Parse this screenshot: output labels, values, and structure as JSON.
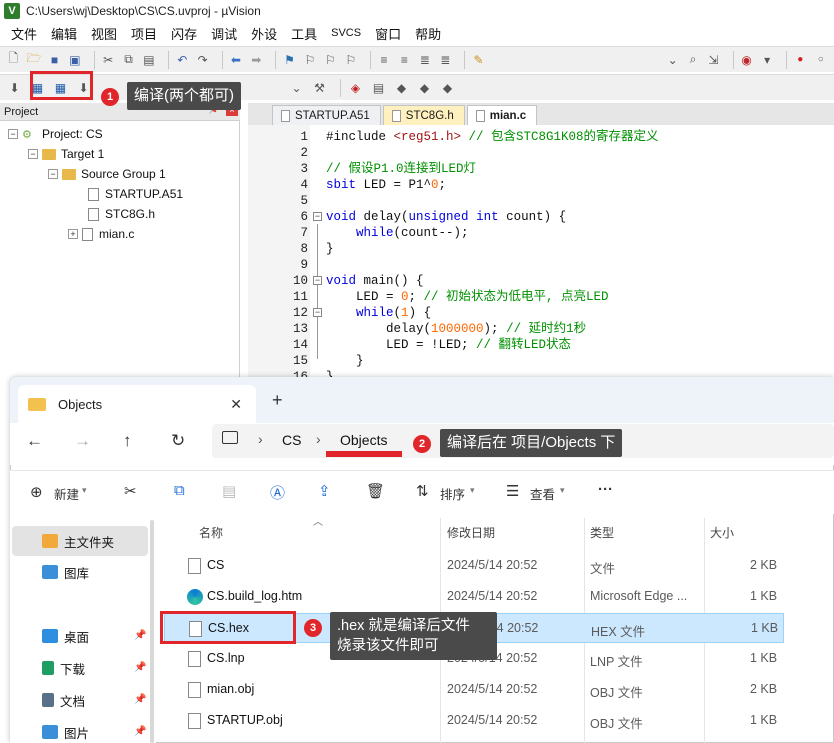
{
  "window": {
    "title": "C:\\Users\\wj\\Desktop\\CS\\CS.uvproj - µVision"
  },
  "menu": [
    "文件",
    "编辑",
    "视图",
    "项目",
    "闪存",
    "调试",
    "外设",
    "工具",
    "SVCS",
    "窗口",
    "帮助"
  ],
  "project": {
    "header": "Project",
    "tree": {
      "root": "Project: CS",
      "target": "Target 1",
      "group": "Source Group 1",
      "files": [
        "STARTUP.A51",
        "STC8G.h",
        "mian.c"
      ]
    }
  },
  "editor": {
    "tabs": [
      "STARTUP.A51",
      "STC8G.h",
      "mian.c"
    ],
    "active_tab": "mian.c",
    "line_numbers": [
      "1",
      "2",
      "3",
      "4",
      "5",
      "6",
      "7",
      "8",
      "9",
      "10",
      "11",
      "12",
      "13",
      "14",
      "15",
      "16"
    ],
    "lines": [
      "#include <reg51.h> // 包含STC8G1K08的寄存器定义",
      "",
      "// 假设P1.0连接到LED灯",
      "sbit LED = P1^0;",
      "",
      "void delay(unsigned int count) {",
      "    while(count--);",
      "}",
      "",
      "void main() {",
      "    LED = 0; // 初始状态为低电平, 点亮LED",
      "    while(1) {",
      "        delay(1000000); // 延时约1秒",
      "        LED = !LED; // 翻转LED状态",
      "    }",
      "}"
    ]
  },
  "annotations": {
    "one": {
      "num": "1",
      "text": "编译(两个都可)"
    },
    "two": {
      "num": "2",
      "text": "编译后在 项目/Objects 下"
    },
    "three": {
      "num": "3",
      "text_line1": ".hex 就是编译后文件",
      "text_line2": "烧录该文件即可"
    }
  },
  "explorer": {
    "tab_title": "Objects",
    "breadcrumb": [
      "CS",
      "Objects"
    ],
    "commands": {
      "new": "新建",
      "sort": "排序",
      "view": "查看",
      "more": "···"
    },
    "nav": [
      {
        "label": "主文件夹",
        "icon": "home-icon"
      },
      {
        "label": "图库",
        "icon": "gallery-icon"
      },
      {
        "label": "桌面",
        "icon": "desktop-icon"
      },
      {
        "label": "下载",
        "icon": "download-icon"
      },
      {
        "label": "文档",
        "icon": "document-icon"
      },
      {
        "label": "图片",
        "icon": "picture-icon"
      }
    ],
    "columns": [
      "名称",
      "修改日期",
      "类型",
      "大小"
    ],
    "files": [
      {
        "name": "CS",
        "date": "2024/5/14 20:52",
        "type": "文件",
        "size": "2 KB"
      },
      {
        "name": "CS.build_log.htm",
        "date": "2024/5/14 20:52",
        "type": "Microsoft Edge ...",
        "size": "1 KB"
      },
      {
        "name": "CS.hex",
        "date": "2024/5/14 20:52",
        "type": "HEX 文件",
        "size": "1 KB"
      },
      {
        "name": "CS.lnp",
        "date": "2024/5/14 20:52",
        "type": "LNP 文件",
        "size": "1 KB"
      },
      {
        "name": "mian.obj",
        "date": "2024/5/14 20:52",
        "type": "OBJ 文件",
        "size": "2 KB"
      },
      {
        "name": "STARTUP.obj",
        "date": "2024/5/14 20:52",
        "type": "OBJ 文件",
        "size": "1 KB"
      }
    ],
    "selected_file": "CS.hex"
  },
  "colors": {
    "accent_red": "#e0262a",
    "callout_bg": "#4a4a4a",
    "selection": "#cce8ff"
  }
}
